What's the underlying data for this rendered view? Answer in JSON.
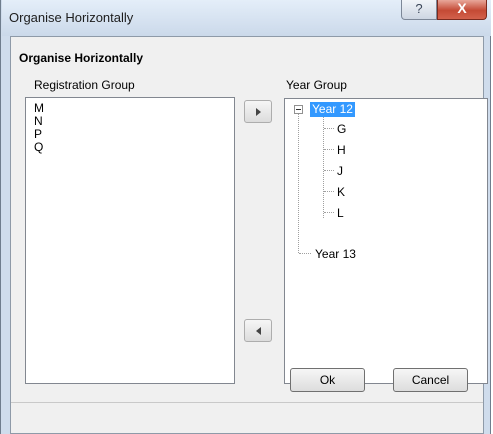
{
  "window": {
    "title": "Organise Horizontally",
    "help_label": "?",
    "close_label": "X"
  },
  "dialog": {
    "group_title": "Organise Horizontally",
    "left_label": "Registration Group",
    "right_label": "Year Group",
    "registration_groups": [
      "M",
      "N",
      "P",
      "Q"
    ],
    "tree": {
      "year12": {
        "label": "Year 12",
        "children": [
          "G",
          "H",
          "J",
          "K",
          "L"
        ],
        "expanded": true,
        "selected": true
      },
      "year13": {
        "label": "Year 13"
      }
    },
    "move_right_icon": "triangle-right-icon",
    "move_left_icon": "triangle-left-icon",
    "ok_label": "Ok",
    "cancel_label": "Cancel",
    "selection_color": "#3399ff"
  }
}
